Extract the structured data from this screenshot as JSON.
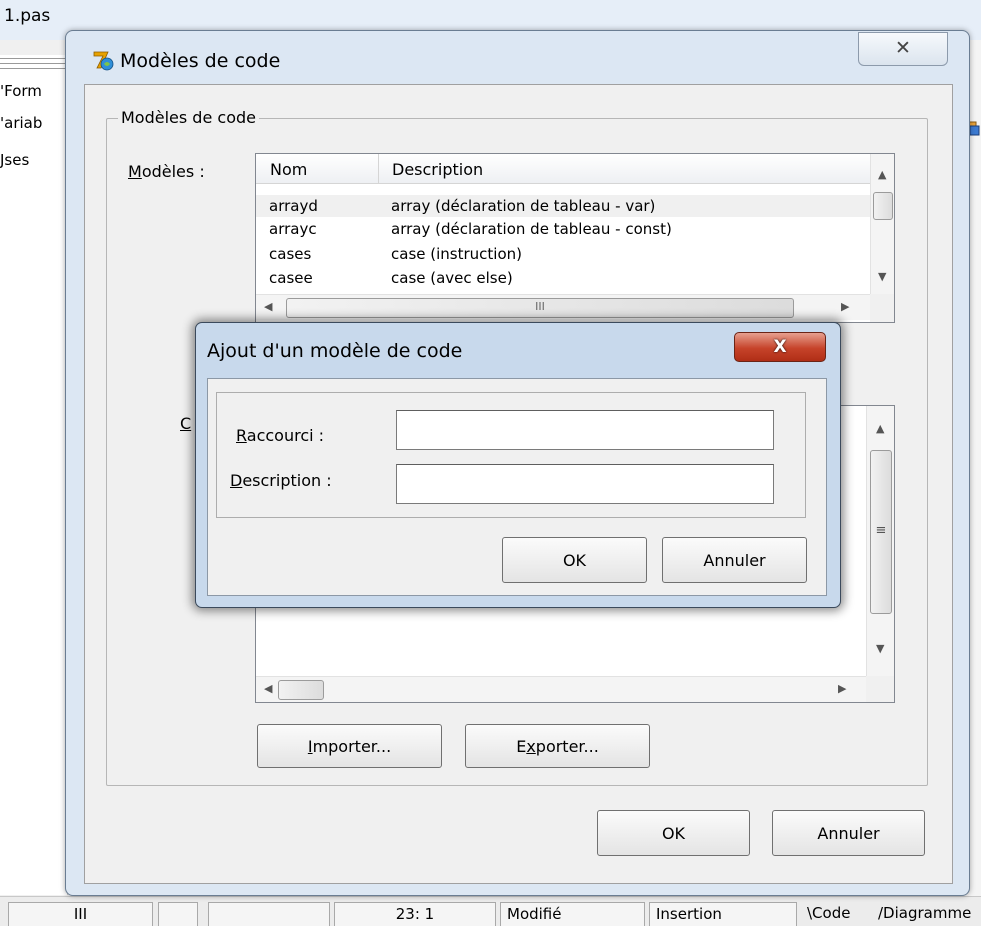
{
  "background_ide": {
    "file_tab": "1.pas",
    "tree_items": [
      "'Form",
      "'ariab",
      "Jses"
    ],
    "status_cells": [
      "III",
      "",
      "",
      "23:  1",
      "Modifié",
      "Insertion",
      "\\Code",
      "/Diagramme"
    ]
  },
  "main_dialog": {
    "title": "Modèles de code",
    "close_glyph": "✕",
    "group_caption": "Modèles de code",
    "templates_label_pre": "",
    "templates_label_accel": "M",
    "templates_label_post": "odèles :",
    "code_label_accel": "C",
    "templates_table": {
      "columns": [
        "Nom",
        "Description"
      ],
      "rows": [
        {
          "name": "arrayd",
          "description": "array  (déclaration de tableau - var)"
        },
        {
          "name": "arrayc",
          "description": "array  (déclaration de tableau - const)"
        },
        {
          "name": "cases",
          "description": "case  (instruction)"
        },
        {
          "name": "casee",
          "description": "case  (avec else)"
        }
      ],
      "selected_row": 0
    },
    "scroll_arrows": {
      "up": "▲",
      "down": "▼",
      "left": "◀",
      "right": "▶",
      "grip_v": "≡",
      "grip_h": "III"
    },
    "import_button": {
      "accel": "I",
      "rest": "mporter..."
    },
    "export_button": {
      "pre": "E",
      "accel": "x",
      "rest": "porter..."
    },
    "ok_label": "OK",
    "cancel_label": "Annuler"
  },
  "add_dialog": {
    "title": "Ajout d'un modèle de code",
    "close_glyph": "X",
    "shortcut_label": {
      "accel": "R",
      "rest": "accourci :"
    },
    "description_label": {
      "accel": "D",
      "rest": "escription :"
    },
    "shortcut_value": "",
    "description_value": "",
    "ok_label": "OK",
    "cancel_label": "Annuler"
  }
}
